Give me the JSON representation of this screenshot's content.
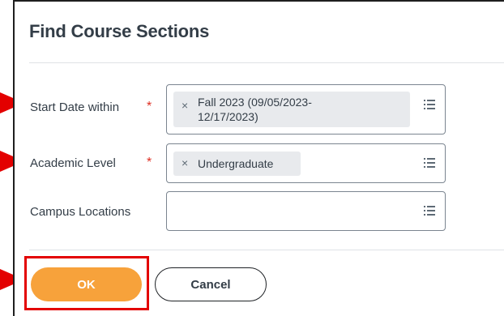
{
  "dialog": {
    "title": "Find Course Sections"
  },
  "fields": {
    "start_date": {
      "label": "Start Date within",
      "required": "*",
      "selected_value": "Fall 2023 (09/05/2023-\n12/17/2023)",
      "remove_icon": "×"
    },
    "academic_level": {
      "label": "Academic Level",
      "required": "*",
      "selected_value": "Undergraduate",
      "remove_icon": "×"
    },
    "campus_locations": {
      "label": "Campus Locations",
      "selected_value": ""
    }
  },
  "buttons": {
    "ok_label": "OK",
    "cancel_label": "Cancel"
  },
  "colors": {
    "accent": "#f7a23b",
    "required": "#de2e21",
    "annotation": "#e30000"
  }
}
